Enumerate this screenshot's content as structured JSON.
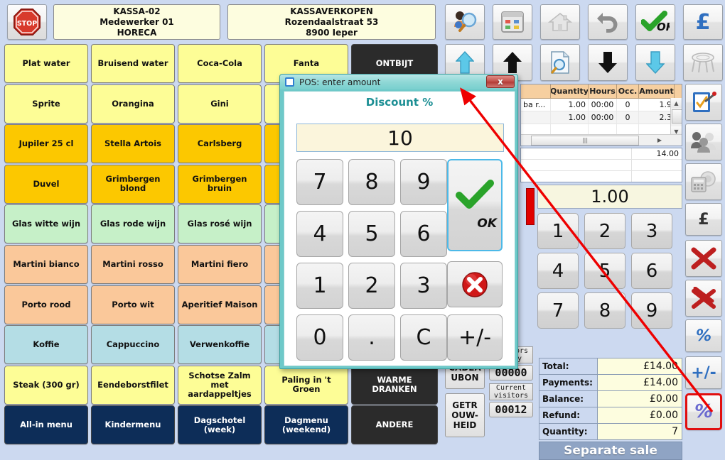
{
  "header": {
    "stop_button": "STOP",
    "register": {
      "line1": "KASSA-02",
      "line2": "Medewerker 01",
      "line3": "HORECA"
    },
    "shop": {
      "line1": "KASSAVERKOPEN",
      "line2": "Rozendaalstraat 53",
      "line3": "8900 Ieper"
    }
  },
  "toolbar_top": [
    {
      "name": "customer-search-icon",
      "label": "Customer search"
    },
    {
      "name": "table-plan-icon",
      "label": "Table plan"
    },
    {
      "name": "home-icon",
      "label": "Home"
    },
    {
      "name": "undo-icon",
      "label": "Undo"
    },
    {
      "name": "ok-icon",
      "label": "OK"
    },
    {
      "name": "pound-icon",
      "label": "£"
    }
  ],
  "toolbar_second": [
    {
      "name": "up-arrow-cyan-icon",
      "label": "Up"
    },
    {
      "name": "up-arrow-black-icon",
      "label": "Move up"
    },
    {
      "name": "document-search-icon",
      "label": "Lookup document"
    },
    {
      "name": "down-arrow-black-icon",
      "label": "Move down"
    },
    {
      "name": "down-arrow-cyan-icon",
      "label": "Down"
    },
    {
      "name": "table-icon",
      "label": "Table"
    }
  ],
  "products": [
    {
      "label": "Plat water",
      "color": "#fdfd96"
    },
    {
      "label": "Bruisend water",
      "color": "#fdfd96"
    },
    {
      "label": "Coca-Cola",
      "color": "#fdfd96"
    },
    {
      "label": "Fanta",
      "color": "#fdfd96"
    },
    {
      "label": "ONTBIJT",
      "color": "#2b2b2b"
    },
    {
      "label": "Sprite",
      "color": "#fdfd96"
    },
    {
      "label": "Orangina",
      "color": "#fdfd96"
    },
    {
      "label": "Gini",
      "color": "#fdfd96"
    },
    {
      "label": "",
      "color": "#fdfd96"
    },
    {
      "label": "",
      "color": "#2b2b2b"
    },
    {
      "label": "Jupiler 25 cl",
      "color": "#fcc800"
    },
    {
      "label": "Stella Artois",
      "color": "#fcc800"
    },
    {
      "label": "Carlsberg",
      "color": "#fcc800"
    },
    {
      "label": "",
      "color": "#fcc800"
    },
    {
      "label": "",
      "color": "#2b2b2b"
    },
    {
      "label": "Duvel",
      "color": "#fcc800"
    },
    {
      "label": "Grimbergen blond",
      "color": "#fcc800"
    },
    {
      "label": "Grimbergen bruin",
      "color": "#fcc800"
    },
    {
      "label": "",
      "color": "#fcc800"
    },
    {
      "label": "",
      "color": "#2b2b2b"
    },
    {
      "label": "Glas witte wijn",
      "color": "#c6f0c8"
    },
    {
      "label": "Glas rode wijn",
      "color": "#c6f0c8"
    },
    {
      "label": "Glas rosé wijn",
      "color": "#c6f0c8"
    },
    {
      "label": "",
      "color": "#c6f0c8"
    },
    {
      "label": "",
      "color": "#2b2b2b"
    },
    {
      "label": "Martini bianco",
      "color": "#fac89a"
    },
    {
      "label": "Martini rosso",
      "color": "#fac89a"
    },
    {
      "label": "Martini fiero",
      "color": "#fac89a"
    },
    {
      "label": "",
      "color": "#fac89a"
    },
    {
      "label": "",
      "color": "#2b2b2b"
    },
    {
      "label": "Porto rood",
      "color": "#fac89a"
    },
    {
      "label": "Porto wit",
      "color": "#fac89a"
    },
    {
      "label": "Aperitief Maison",
      "color": "#fac89a"
    },
    {
      "label": "",
      "color": "#fac89a"
    },
    {
      "label": "",
      "color": "#2b2b2b"
    },
    {
      "label": "Koffie",
      "color": "#b4dde5"
    },
    {
      "label": "Cappuccino",
      "color": "#b4dde5"
    },
    {
      "label": "Verwenkoffie",
      "color": "#b4dde5"
    },
    {
      "label": "",
      "color": "#b4dde5"
    },
    {
      "label": "",
      "color": "#2b2b2b"
    },
    {
      "label": "Steak (300 gr)",
      "color": "#fdfd96"
    },
    {
      "label": "Eendeborstfilet",
      "color": "#fdfd96"
    },
    {
      "label": "Schotse Zalm met aardappeltjes",
      "color": "#fdfd96"
    },
    {
      "label": "Paling in 't Groen",
      "color": "#fdfd96"
    },
    {
      "label": "WARME DRANKEN",
      "color": "#2b2b2b"
    },
    {
      "label": "All-in menu",
      "color": "#0d2d58"
    },
    {
      "label": "Kindermenu",
      "color": "#0d2d58"
    },
    {
      "label": "Dagschotel (week)",
      "color": "#0d2d58"
    },
    {
      "label": "Dagmenu (weekend)",
      "color": "#0d2d58"
    },
    {
      "label": "ANDERE",
      "color": "#2b2b2b"
    }
  ],
  "grid": {
    "columns": [
      "Quantity",
      "Hours",
      "Occ.",
      "Amount"
    ],
    "rows": [
      {
        "desc": "ba r...",
        "quantity": "1.00",
        "hours": "00:00",
        "occ": "0",
        "amount": "1.9"
      },
      {
        "desc": "",
        "quantity": "1.00",
        "hours": "00:00",
        "occ": "0",
        "amount": "2.3"
      },
      {
        "desc": "",
        "quantity": "",
        "hours": "",
        "occ": "",
        "amount": ""
      }
    ],
    "subtotal": "14.00"
  },
  "amount_display": "1.00",
  "numpad_keys": [
    "1",
    "2",
    "3",
    "4",
    "5",
    "6",
    "7",
    "8",
    "9"
  ],
  "side_buttons": [
    {
      "name": "cadeaubon-button",
      "label": "CADEA UBON"
    },
    {
      "name": "getrouwheid-button",
      "label": "GETR OUW- HEID"
    }
  ],
  "counters": [
    {
      "name": "visitors-today",
      "label": "Visitors today",
      "value": "00000"
    },
    {
      "name": "current-visitors",
      "label": "Current visitors",
      "value": "00012"
    }
  ],
  "totals": [
    {
      "label": "Total:",
      "value": "£14.00"
    },
    {
      "label": "Payments:",
      "value": "£14.00"
    },
    {
      "label": "Balance:",
      "value": "£0.00"
    },
    {
      "label": "Refund:",
      "value": "£0.00"
    },
    {
      "label": "Quantity:",
      "value": "7"
    }
  ],
  "separate_sale": "Separate sale",
  "toolbar_right": [
    {
      "name": "stool-icon",
      "label": "Table / stool"
    },
    {
      "name": "edit-order-icon",
      "label": "Edit order"
    },
    {
      "name": "customers-icon",
      "label": "Customers"
    },
    {
      "name": "cash-register-icon",
      "label": "Cash register"
    },
    {
      "name": "pound-currency-icon",
      "label": "£"
    },
    {
      "name": "delete-line-icon",
      "label": "Delete line"
    },
    {
      "name": "delete-all-icon",
      "label": "Delete all"
    },
    {
      "name": "percent-icon",
      "label": "%"
    },
    {
      "name": "plus-minus-icon",
      "label": "+/-"
    },
    {
      "name": "discount-percent-icon",
      "label": "Discount %"
    }
  ],
  "modal": {
    "title": "POS: enter amount",
    "close_label": "x",
    "subtitle": "Discount %",
    "value": "10",
    "keys": [
      "7",
      "8",
      "9",
      "4",
      "5",
      "6",
      "1",
      "2",
      "3",
      "0",
      ".",
      "C",
      "+/-"
    ],
    "ok_label": "OK"
  },
  "colors": {
    "window_bg": "#ccd9f0",
    "modal_frame": "#6ec9c9",
    "modal_title_text": "#1d8f94",
    "highlight_border": "#e10e0e",
    "annotation_arrow": "#ee0000",
    "separate_sale_bg": "#8fa4c4"
  }
}
